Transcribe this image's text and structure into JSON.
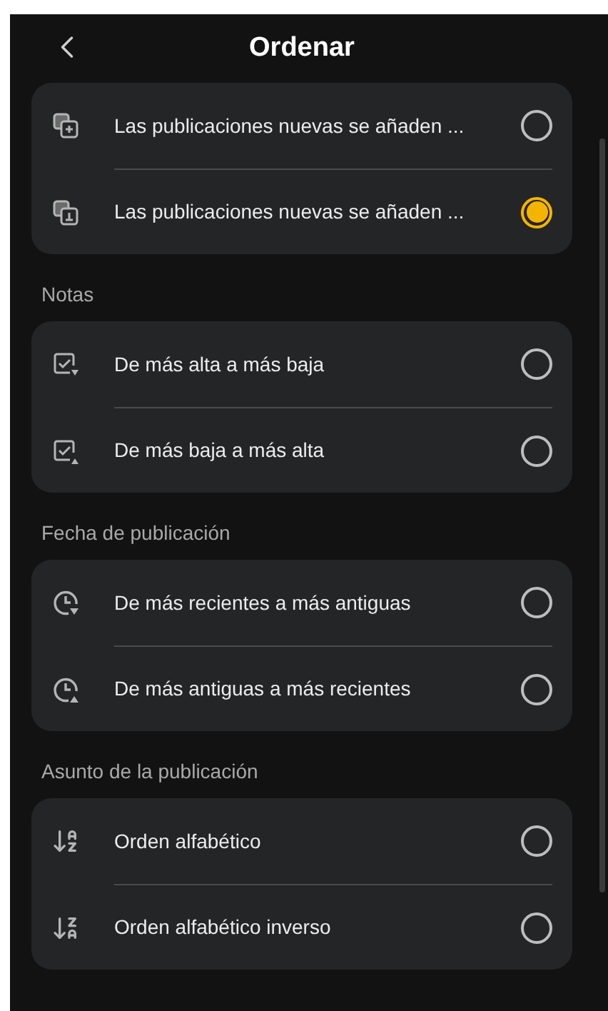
{
  "header": {
    "title": "Ordenar"
  },
  "sections": [
    {
      "options": [
        {
          "label": "Las publicaciones nuevas se añaden ...",
          "selected": false
        },
        {
          "label": "Las publicaciones nuevas se añaden ...",
          "selected": true
        }
      ]
    },
    {
      "label": "Notas",
      "options": [
        {
          "label": "De más alta a más baja",
          "selected": false
        },
        {
          "label": "De más baja a más alta",
          "selected": false
        }
      ]
    },
    {
      "label": "Fecha de publicación",
      "options": [
        {
          "label": "De más recientes a más antiguas",
          "selected": false
        },
        {
          "label": "De más antiguas a más recientes",
          "selected": false
        }
      ]
    },
    {
      "label": "Asunto de la publicación",
      "options": [
        {
          "label": "Orden alfabético",
          "selected": false
        },
        {
          "label": "Orden alfabético inverso",
          "selected": false
        }
      ]
    }
  ]
}
